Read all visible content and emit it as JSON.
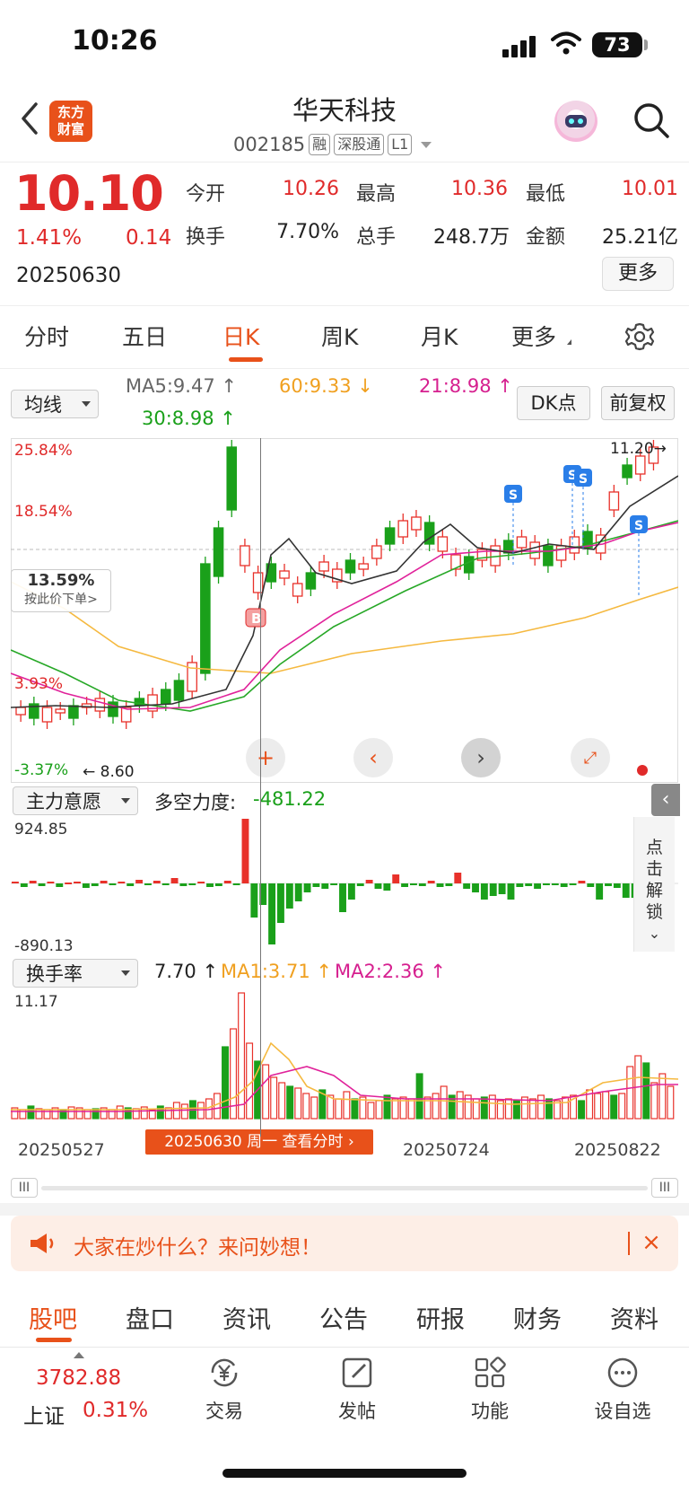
{
  "status_bar": {
    "time": "10:26",
    "battery": "73"
  },
  "header": {
    "logo_line1": "东方",
    "logo_line2": "财富",
    "stock_name": "华天科技",
    "stock_code": "002185",
    "tags": [
      "融",
      "深股通",
      "L1"
    ]
  },
  "quote": {
    "price": "10.10",
    "change_pct": "1.41%",
    "change": "0.14",
    "date": "20250630",
    "fields": [
      {
        "label": "今开",
        "value": "10.26",
        "red": true
      },
      {
        "label": "最高",
        "value": "10.36",
        "red": true
      },
      {
        "label": "最低",
        "value": "10.01",
        "red": true
      },
      {
        "label": "换手",
        "value": "7.70%",
        "red": false
      },
      {
        "label": "总手",
        "value": "248.7万",
        "red": false
      },
      {
        "label": "金额",
        "value": "25.21亿",
        "red": false
      }
    ],
    "more_label": "更多"
  },
  "tabs": [
    {
      "label": "分时",
      "active": false
    },
    {
      "label": "五日",
      "active": false
    },
    {
      "label": "日K",
      "active": true
    },
    {
      "label": "周K",
      "active": false
    },
    {
      "label": "月K",
      "active": false
    },
    {
      "label": "更多",
      "active": false
    }
  ],
  "ma_row": {
    "selector": "均线",
    "ma5": "MA5:9.47",
    "ma60": "60:9.33",
    "ma21": "21:8.98",
    "ma30": "30:8.98",
    "dk_label": "DK点",
    "adjust_label": "前复权"
  },
  "chart": {
    "y_labels": [
      "25.84%",
      "18.54%",
      "3.93%",
      "-3.37%"
    ],
    "low_label": "8.60",
    "high_label": "11.20",
    "price_tag_value": "13.59%",
    "price_tag_sub": "按此价下单>",
    "buy_marker": "B",
    "sell_marker": "S",
    "colors": {
      "up": "#e8312a",
      "down": "#1aa01a",
      "ma5": "#333333",
      "ma21": "#e0229a",
      "ma30": "#27a827",
      "ma60": "#f5b940"
    }
  },
  "indicator1": {
    "selector": "主力意愿",
    "name": "多空力度:",
    "value": "-481.22",
    "max_label": "924.85",
    "min_label": "-890.13",
    "unlock_text": [
      "点",
      "击",
      "解",
      "锁"
    ]
  },
  "indicator2": {
    "selector": "换手率",
    "value": "7.70",
    "ma1": "MA1:3.71",
    "ma2": "MA2:2.36",
    "max_label": "11.17",
    "dates": [
      "20250527",
      "20250724",
      "20250822"
    ],
    "date_pill": "20250630 周一  查看分时"
  },
  "ask_banner": {
    "text": "大家在炒什么？来问妙想！"
  },
  "bottom_tabs": [
    {
      "label": "股吧",
      "active": true
    },
    {
      "label": "盘口",
      "active": false
    },
    {
      "label": "资讯",
      "active": false
    },
    {
      "label": "公告",
      "active": false
    },
    {
      "label": "研报",
      "active": false
    },
    {
      "label": "财务",
      "active": false
    },
    {
      "label": "资料",
      "active": false
    }
  ],
  "bottom_nav": {
    "index_value": "3782.88",
    "index_name": "上证",
    "index_pct": "0.31%",
    "items": [
      {
        "label": "交易",
        "icon": "yen-exchange-icon"
      },
      {
        "label": "发帖",
        "icon": "edit-icon"
      },
      {
        "label": "功能",
        "icon": "grid-icon"
      },
      {
        "label": "设自选",
        "icon": "more-dots-icon"
      }
    ]
  }
}
